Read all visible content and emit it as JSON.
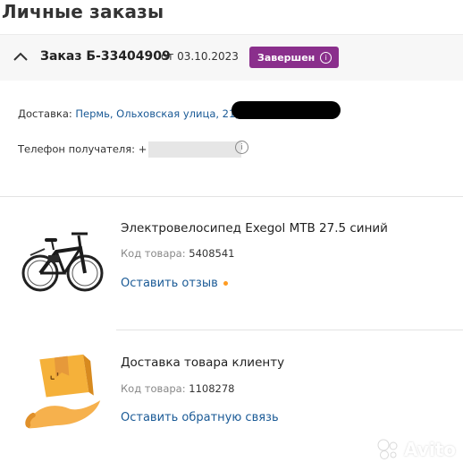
{
  "page": {
    "title": "Личные заказы"
  },
  "order": {
    "number": "Заказ Б-33404909",
    "date": "от 03.10.2023",
    "status": "Завершен",
    "status_color": "#8a2f8c"
  },
  "details": {
    "delivery_label": "Доставка:",
    "delivery_address": "Пермь, Ольховская улица, 21,",
    "phone_label": "Телефон получателя:",
    "phone_prefix": "+"
  },
  "products": [
    {
      "title": "Электровелосипед Exegol MTB 27.5 синий",
      "code_label": "Код товара:",
      "code": "5408541",
      "action": "Оставить отзыв",
      "icon": "bicycle-icon"
    },
    {
      "title": "Доставка товара клиенту",
      "code_label": "Код товара:",
      "code": "1108278",
      "action": "Оставить обратную связь",
      "icon": "delivery-box-icon"
    }
  ],
  "watermark": {
    "text": "Avito"
  },
  "colors": {
    "link": "#1a5a96",
    "accent_dot": "#ff9b21"
  }
}
